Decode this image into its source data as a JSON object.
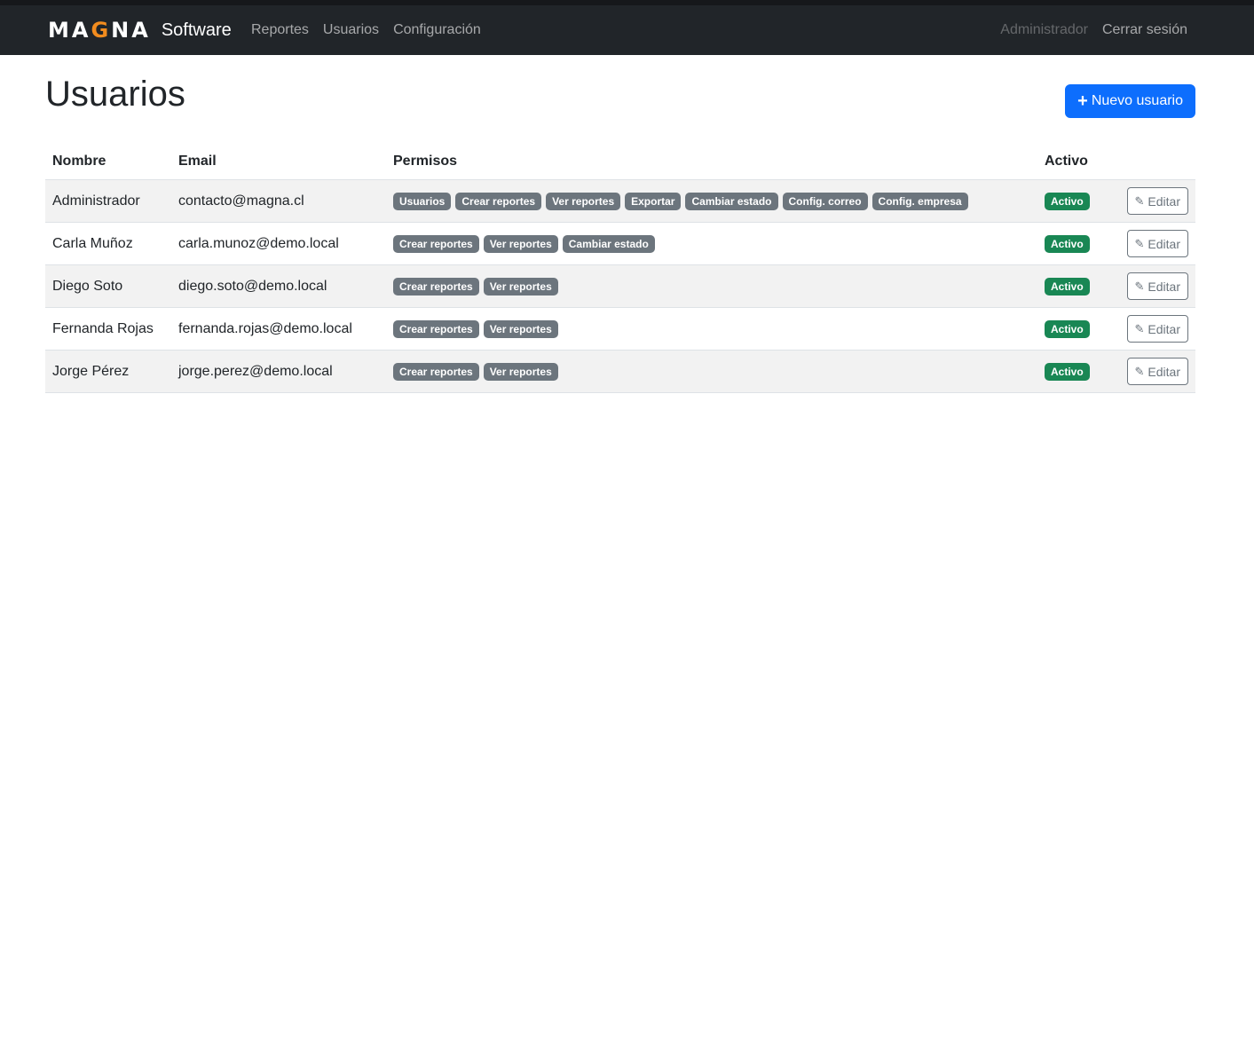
{
  "navbar": {
    "logo": {
      "part1": "MA",
      "accent": "G",
      "part2": "NA"
    },
    "brand_sub": "Software",
    "links": [
      "Reportes",
      "Usuarios",
      "Configuración"
    ],
    "user": "Administrador",
    "logout": "Cerrar sesión"
  },
  "page": {
    "title": "Usuarios",
    "new_user_button": "Nuevo usuario",
    "new_user_icon": "plus-icon"
  },
  "table": {
    "headers": [
      "Nombre",
      "Email",
      "Permisos",
      "Activo",
      ""
    ],
    "edit_label": "Editar",
    "edit_icon": "pencil-icon",
    "rows": [
      {
        "name": "Administrador",
        "email": "contacto@magna.cl",
        "perms": [
          "Usuarios",
          "Crear reportes",
          "Ver reportes",
          "Exportar",
          "Cambiar estado",
          "Config. correo",
          "Config. empresa"
        ],
        "active": "Activo"
      },
      {
        "name": "Carla Muñoz",
        "email": "carla.munoz@demo.local",
        "perms": [
          "Crear reportes",
          "Ver reportes",
          "Cambiar estado"
        ],
        "active": "Activo"
      },
      {
        "name": "Diego Soto",
        "email": "diego.soto@demo.local",
        "perms": [
          "Crear reportes",
          "Ver reportes"
        ],
        "active": "Activo"
      },
      {
        "name": "Fernanda Rojas",
        "email": "fernanda.rojas@demo.local",
        "perms": [
          "Crear reportes",
          "Ver reportes"
        ],
        "active": "Activo"
      },
      {
        "name": "Jorge Pérez",
        "email": "jorge.perez@demo.local",
        "perms": [
          "Crear reportes",
          "Ver reportes"
        ],
        "active": "Activo"
      }
    ]
  },
  "colors": {
    "navbar_bg": "#212529",
    "logo_accent": "#f28c1e",
    "primary": "#0d6efd",
    "badge_perm": "#6c757d",
    "badge_active": "#198754"
  }
}
